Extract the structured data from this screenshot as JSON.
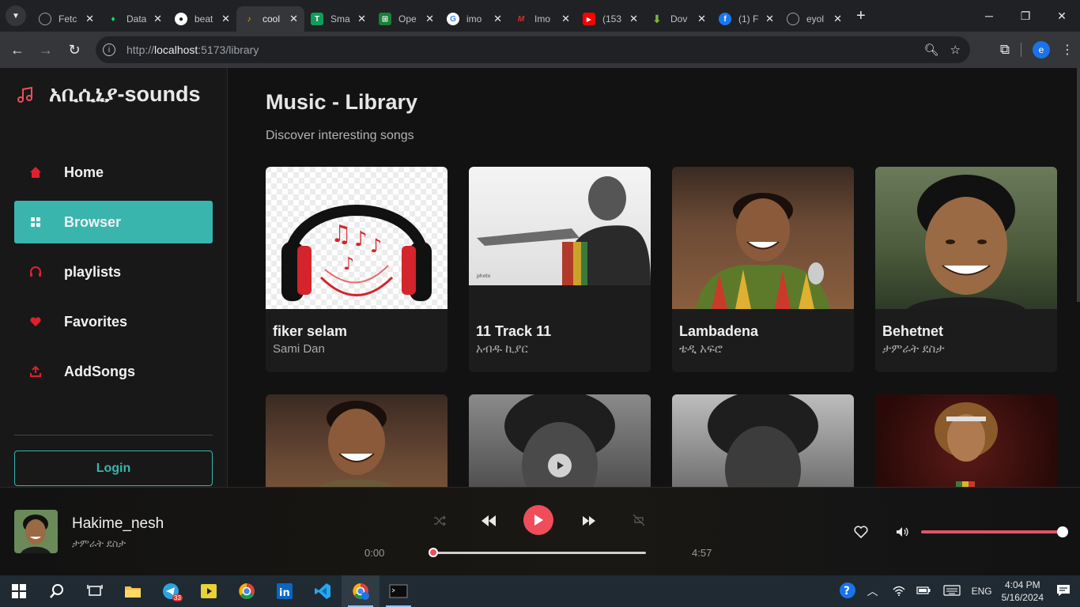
{
  "browser": {
    "tabs": [
      {
        "label": "Fetc",
        "icon": "globe-icon",
        "color": "#5f6368"
      },
      {
        "label": "Data",
        "icon": "mongodb-leaf-icon",
        "color": "#00ed64"
      },
      {
        "label": "beat",
        "icon": "github-icon",
        "color": "#ffffff"
      },
      {
        "label": "cool",
        "icon": "music-note-icon",
        "color": "#f9ab00",
        "active": true
      },
      {
        "label": "Sma",
        "icon": "sheets-icon",
        "color": "#0f9d58"
      },
      {
        "label": "Ope",
        "icon": "sheet-grid-icon",
        "color": "#188038"
      },
      {
        "label": "imo",
        "icon": "google-icon",
        "color": "#4285f4"
      },
      {
        "label": "Imo",
        "icon": "m-logo-icon",
        "color": "#d93025"
      },
      {
        "label": "(153",
        "icon": "youtube-icon",
        "color": "#ff0000"
      },
      {
        "label": "Dov",
        "icon": "download-arrow-icon",
        "color": "#7cb342"
      },
      {
        "label": "(1) F",
        "icon": "facebook-icon",
        "color": "#1877f2"
      },
      {
        "label": "eyol",
        "icon": "globe-icon",
        "color": "#9aa0a6"
      }
    ],
    "url_prefix": "http://",
    "url_host": "localhost",
    "url_path": ":5173/library",
    "profile_initial": "e"
  },
  "sidebar": {
    "brand": "አቢሲኒያ-sounds",
    "accent": "#ef4d5a",
    "active_color": "#3ab5ad",
    "items": [
      {
        "label": "Home",
        "icon": "home-icon"
      },
      {
        "label": "Browser",
        "icon": "grid-icon",
        "active": true
      },
      {
        "label": "playlists",
        "icon": "headphones-icon"
      },
      {
        "label": "Favorites",
        "icon": "heart-icon"
      },
      {
        "label": "AddSongs",
        "icon": "upload-icon"
      }
    ],
    "login_label": "Login"
  },
  "main": {
    "title": "Music - Library",
    "subtitle": "Discover interesting songs",
    "songs": [
      {
        "title": "fiker selam",
        "artist": "Sami Dan",
        "cover": "headphones-art"
      },
      {
        "title": "11 Track 11",
        "artist": "አብዱ ኪያር",
        "cover": "bw-singer-photo"
      },
      {
        "title": "Lambadena",
        "artist": "ቴዲ አፍሮ",
        "cover": "singer-photo-smiling"
      },
      {
        "title": "Behetnet",
        "artist": "ታምራት ደስታ",
        "cover": "singer-portrait"
      },
      {
        "title": "",
        "artist": "",
        "cover": "singer-photo-smiling"
      },
      {
        "title": "",
        "artist": "",
        "cover": "bw-portrait"
      },
      {
        "title": "",
        "artist": "",
        "cover": "bw-portrait"
      },
      {
        "title": "",
        "artist": "",
        "cover": "singer-stage-photo"
      }
    ]
  },
  "player": {
    "title": "Hakime_nesh",
    "artist": "ታምራት ደስታ",
    "current_time": "0:00",
    "duration": "4:57",
    "progress": 0.0,
    "volume": 1.0
  },
  "taskbar": {
    "language": "ENG",
    "time": "4:04 PM",
    "date": "5/16/2024",
    "telegram_badge": "33"
  }
}
